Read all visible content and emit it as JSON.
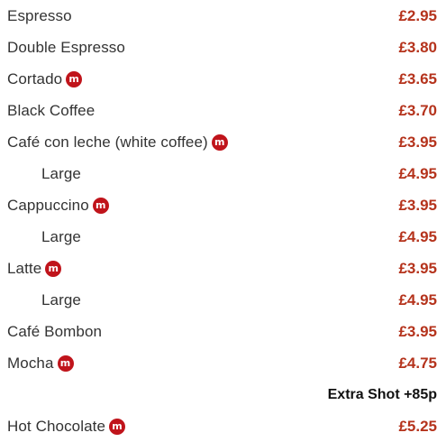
{
  "colors": {
    "text": "#333333",
    "price": "#b5331c",
    "badge": "#c0141b",
    "note": "#111111"
  },
  "badge_icon": "m-badge-icon",
  "items": [
    {
      "name": "Espresso",
      "price": "£2.95"
    },
    {
      "name": "Double Espresso",
      "price": "£3.80"
    },
    {
      "name": "Cortado",
      "price": "£3.65",
      "badge": "m"
    },
    {
      "name": "Black Coffee",
      "price": "£3.70"
    },
    {
      "name": "Café con leche (white coffee)",
      "price": "£3.95",
      "badge": "m"
    },
    {
      "name": "Large",
      "price": "£4.95"
    },
    {
      "name": "Cappuccino",
      "price": "£3.95",
      "badge": "m"
    },
    {
      "name": "Large",
      "price": "£4.95"
    },
    {
      "name": "Latte",
      "price": "£3.95",
      "badge": "m"
    },
    {
      "name": "Large",
      "price": "£4.95"
    },
    {
      "name": "Café Bombon",
      "price": "£3.95"
    },
    {
      "name": "Mocha",
      "price": "£4.75",
      "badge": "m"
    },
    {
      "name": "Hot Chocolate",
      "price": "£5.25",
      "badge": "m"
    }
  ],
  "extra_shot_note": "Extra Shot +85p"
}
